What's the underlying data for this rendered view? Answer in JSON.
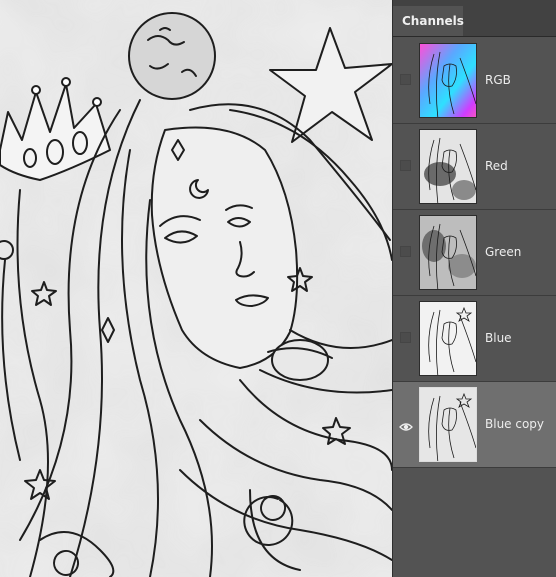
{
  "panel": {
    "tab_label": "Channels",
    "channels": [
      {
        "label": "RGB",
        "visible": false,
        "thumbnail": "color-line-art"
      },
      {
        "label": "Red",
        "visible": false,
        "thumbnail": "red-channel-grayscale"
      },
      {
        "label": "Green",
        "visible": false,
        "thumbnail": "green-channel-grayscale"
      },
      {
        "label": "Blue",
        "visible": false,
        "thumbnail": "blue-channel-grayscale"
      },
      {
        "label": "Blue copy",
        "visible": true,
        "selected": true,
        "thumbnail": "blue-copy-grayscale"
      }
    ]
  },
  "canvas": {
    "content": "grayscale line-art illustration of a crowned woman with flowing hair, stars, moon and planet"
  },
  "colors": {
    "panel_bg": "#535353",
    "tab_bar_bg": "#424242",
    "selected_row_bg": "#6f6f6f",
    "text": "#ededed"
  }
}
